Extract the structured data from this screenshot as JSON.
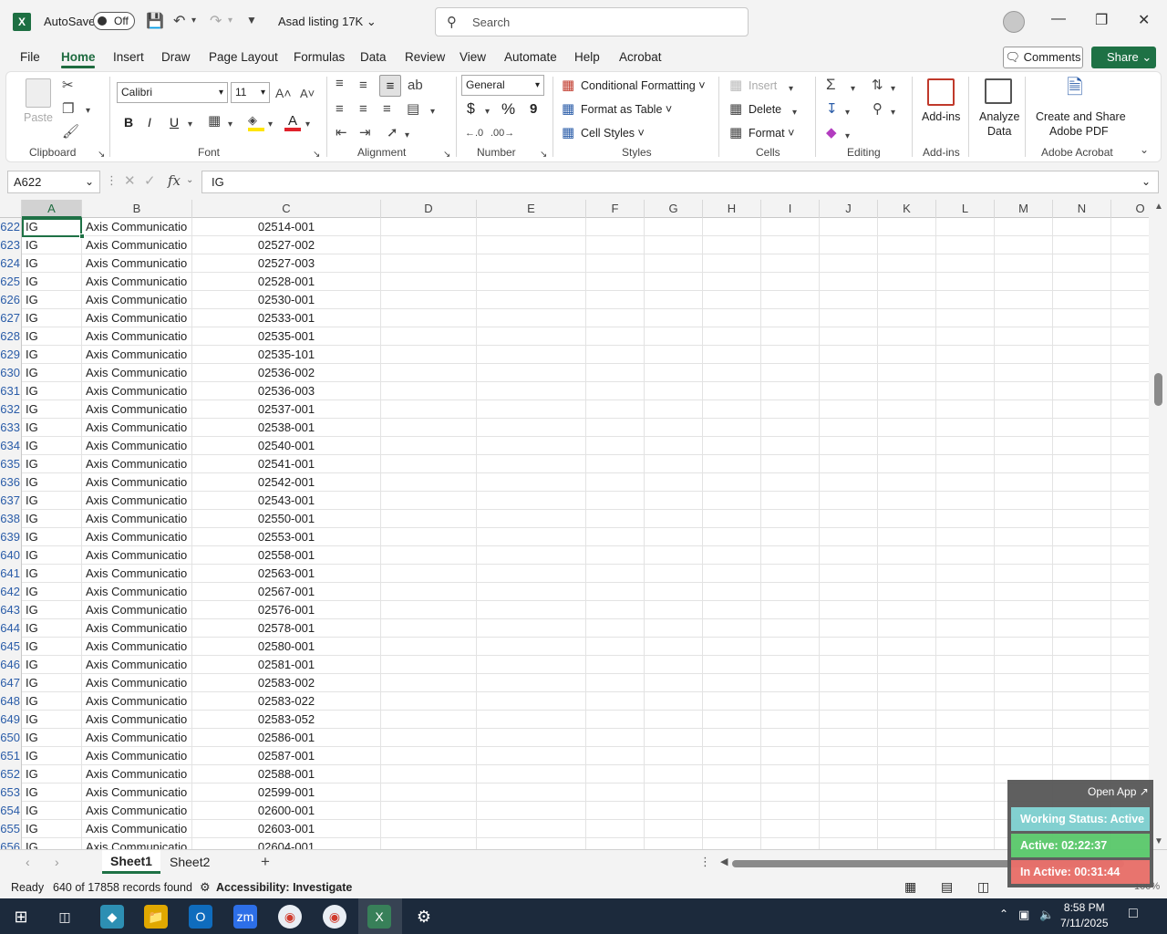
{
  "app": {
    "autosave_label": "AutoSave",
    "autosave_state": "Off",
    "doc_title": "Asad listing 17K",
    "search_placeholder": "Search"
  },
  "tabs": [
    "File",
    "Home",
    "Insert",
    "Draw",
    "Page Layout",
    "Formulas",
    "Data",
    "Review",
    "View",
    "Automate",
    "Help",
    "Acrobat"
  ],
  "top_buttons": {
    "comments": "Comments",
    "share": "Share"
  },
  "ribbon": {
    "clipboard": {
      "paste": "Paste",
      "label": "Clipboard"
    },
    "font": {
      "name": "Calibri",
      "size": "11",
      "bold": "B",
      "italic": "I",
      "underline": "U",
      "label": "Font"
    },
    "alignment": {
      "label": "Alignment"
    },
    "number": {
      "format": "General",
      "currency": "$",
      "percent": "%",
      "comma": "9",
      "label": "Number"
    },
    "styles": {
      "conditional": "Conditional Formatting",
      "table": "Format as Table",
      "cell_styles": "Cell Styles",
      "label": "Styles"
    },
    "cells": {
      "insert": "Insert",
      "delete": "Delete",
      "format": "Format",
      "label": "Cells"
    },
    "editing": {
      "label": "Editing"
    },
    "addins": {
      "addins": "Add-ins",
      "label": "Add-ins"
    },
    "analyze": {
      "line1": "Analyze",
      "line2": "Data"
    },
    "acrobat": {
      "line1": "Create and Share",
      "line2": "Adobe PDF",
      "label": "Adobe Acrobat"
    }
  },
  "formula_bar": {
    "name_box": "A622",
    "fx": "fx",
    "value": "IG"
  },
  "columns": [
    "A",
    "B",
    "C",
    "D",
    "E",
    "F",
    "G",
    "H",
    "I",
    "J",
    "K",
    "L",
    "M",
    "N",
    "O"
  ],
  "rows": [
    {
      "n": "622",
      "a": "IG",
      "b": "Axis Communicatio",
      "c": "02514-001"
    },
    {
      "n": "623",
      "a": "IG",
      "b": "Axis Communicatio",
      "c": "02527-002"
    },
    {
      "n": "624",
      "a": "IG",
      "b": "Axis Communicatio",
      "c": "02527-003"
    },
    {
      "n": "625",
      "a": "IG",
      "b": "Axis Communicatio",
      "c": "02528-001"
    },
    {
      "n": "626",
      "a": "IG",
      "b": "Axis Communicatio",
      "c": "02530-001"
    },
    {
      "n": "627",
      "a": "IG",
      "b": "Axis Communicatio",
      "c": "02533-001"
    },
    {
      "n": "628",
      "a": "IG",
      "b": "Axis Communicatio",
      "c": "02535-001"
    },
    {
      "n": "629",
      "a": "IG",
      "b": "Axis Communicatio",
      "c": "02535-101"
    },
    {
      "n": "630",
      "a": "IG",
      "b": "Axis Communicatio",
      "c": "02536-002"
    },
    {
      "n": "631",
      "a": "IG",
      "b": "Axis Communicatio",
      "c": "02536-003"
    },
    {
      "n": "632",
      "a": "IG",
      "b": "Axis Communicatio",
      "c": "02537-001"
    },
    {
      "n": "633",
      "a": "IG",
      "b": "Axis Communicatio",
      "c": "02538-001"
    },
    {
      "n": "634",
      "a": "IG",
      "b": "Axis Communicatio",
      "c": "02540-001"
    },
    {
      "n": "635",
      "a": "IG",
      "b": "Axis Communicatio",
      "c": "02541-001"
    },
    {
      "n": "636",
      "a": "IG",
      "b": "Axis Communicatio",
      "c": "02542-001"
    },
    {
      "n": "637",
      "a": "IG",
      "b": "Axis Communicatio",
      "c": "02543-001"
    },
    {
      "n": "638",
      "a": "IG",
      "b": "Axis Communicatio",
      "c": "02550-001"
    },
    {
      "n": "639",
      "a": "IG",
      "b": "Axis Communicatio",
      "c": "02553-001"
    },
    {
      "n": "640",
      "a": "IG",
      "b": "Axis Communicatio",
      "c": "02558-001"
    },
    {
      "n": "641",
      "a": "IG",
      "b": "Axis Communicatio",
      "c": "02563-001"
    },
    {
      "n": "642",
      "a": "IG",
      "b": "Axis Communicatio",
      "c": "02567-001"
    },
    {
      "n": "643",
      "a": "IG",
      "b": "Axis Communicatio",
      "c": "02576-001"
    },
    {
      "n": "644",
      "a": "IG",
      "b": "Axis Communicatio",
      "c": "02578-001"
    },
    {
      "n": "645",
      "a": "IG",
      "b": "Axis Communicatio",
      "c": "02580-001"
    },
    {
      "n": "646",
      "a": "IG",
      "b": "Axis Communicatio",
      "c": "02581-001"
    },
    {
      "n": "647",
      "a": "IG",
      "b": "Axis Communicatio",
      "c": "02583-002"
    },
    {
      "n": "648",
      "a": "IG",
      "b": "Axis Communicatio",
      "c": "02583-022"
    },
    {
      "n": "649",
      "a": "IG",
      "b": "Axis Communicatio",
      "c": "02583-052"
    },
    {
      "n": "650",
      "a": "IG",
      "b": "Axis Communicatio",
      "c": "02586-001"
    },
    {
      "n": "651",
      "a": "IG",
      "b": "Axis Communicatio",
      "c": "02587-001"
    },
    {
      "n": "652",
      "a": "IG",
      "b": "Axis Communicatio",
      "c": "02588-001"
    },
    {
      "n": "653",
      "a": "IG",
      "b": "Axis Communicatio",
      "c": "02599-001"
    },
    {
      "n": "654",
      "a": "IG",
      "b": "Axis Communicatio",
      "c": "02600-001"
    },
    {
      "n": "655",
      "a": "IG",
      "b": "Axis Communicatio",
      "c": "02603-001"
    },
    {
      "n": "656",
      "a": "IG",
      "b": "Axis Communicatio",
      "c": "02604-001"
    }
  ],
  "sheets": {
    "sheet1": "Sheet1",
    "sheet2": "Sheet2"
  },
  "status": {
    "ready": "Ready",
    "records": "640 of 17858 records found",
    "accessibility": "Accessibility: Investigate",
    "zoom": "100%"
  },
  "widget": {
    "open_app": "Open App ↗",
    "working": "Working Status: Active",
    "active": "Active: 02:22:37",
    "inactive": "In Active: 00:31:44"
  },
  "clock": {
    "time": "8:58 PM",
    "date": "7/11/2025"
  },
  "colors": {
    "excel_green": "#1e7145",
    "widget_teal": "#7ecfcf",
    "widget_green": "#5cc96d",
    "widget_red": "#e8706a",
    "taskbar": "#1c2a3c"
  }
}
